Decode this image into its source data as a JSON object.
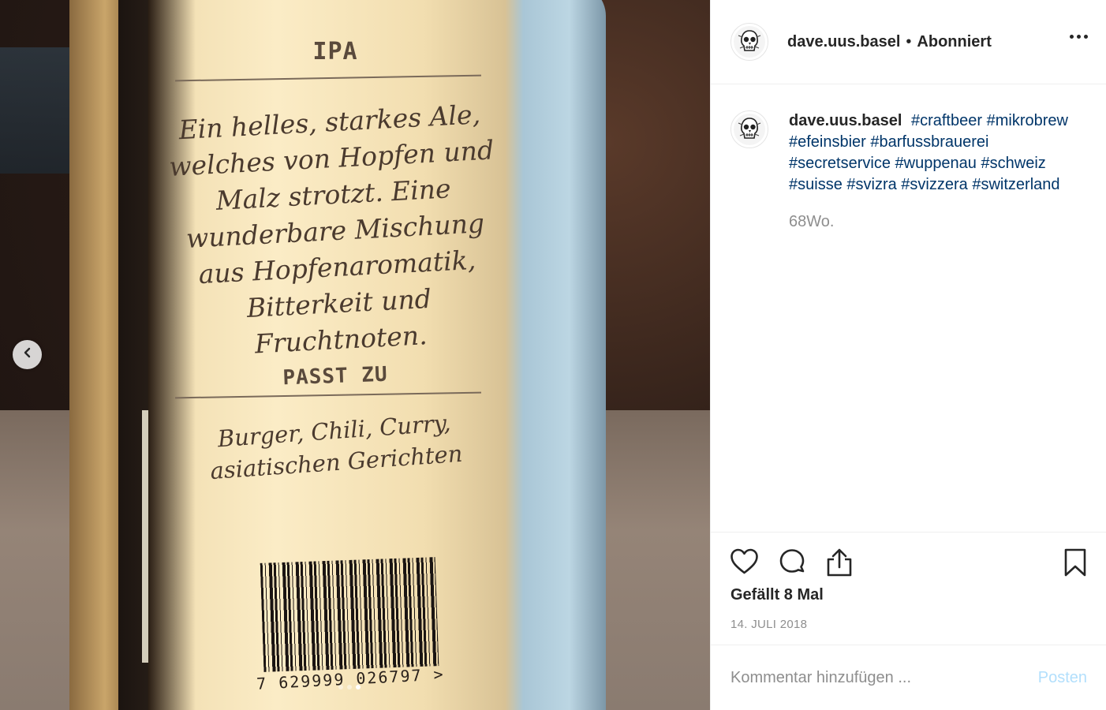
{
  "post": {
    "photo": {
      "label_title": "IPA",
      "label_description": "Ein helles, starkes Ale, welches von Hopfen und Malz strotzt. Eine wunderbare Mischung aus Hopfenaromatik, Bitterkeit und Fruchtnoten.",
      "label_pairing_heading": "PASST ZU",
      "label_pairing": "Burger, Chili, Curry, asiatischen Gerichten",
      "barcode_digits": "7 629999 026797 >",
      "carousel_count": 3,
      "carousel_active": 3
    },
    "header": {
      "username": "dave.uus.basel",
      "separator": "•",
      "follow_state": "Abonniert"
    },
    "caption": {
      "username": "dave.uus.basel",
      "hashtags": [
        "#craftbeer",
        "#mikrobrew",
        "#efeinsbier",
        "#barfussbrauerei",
        "#secretservice",
        "#wuppenau",
        "#schweiz",
        "#suisse",
        "#svizra",
        "#svizzera",
        "#switzerland"
      ],
      "time_ago": "68Wo."
    },
    "stats": {
      "likes_text": "Gefällt 8 Mal",
      "date": "14. JULI 2018"
    },
    "comment": {
      "placeholder": "Kommentar hinzufügen ...",
      "post_label": "Posten"
    },
    "colors": {
      "hashtag": "#003569",
      "muted": "#8e8e8e",
      "post_disabled": "#b2dffc"
    },
    "icons": [
      "chevron-left-icon",
      "more-options-icon",
      "heart-icon",
      "comment-icon",
      "share-icon",
      "bookmark-icon",
      "avatar-skull"
    ]
  }
}
